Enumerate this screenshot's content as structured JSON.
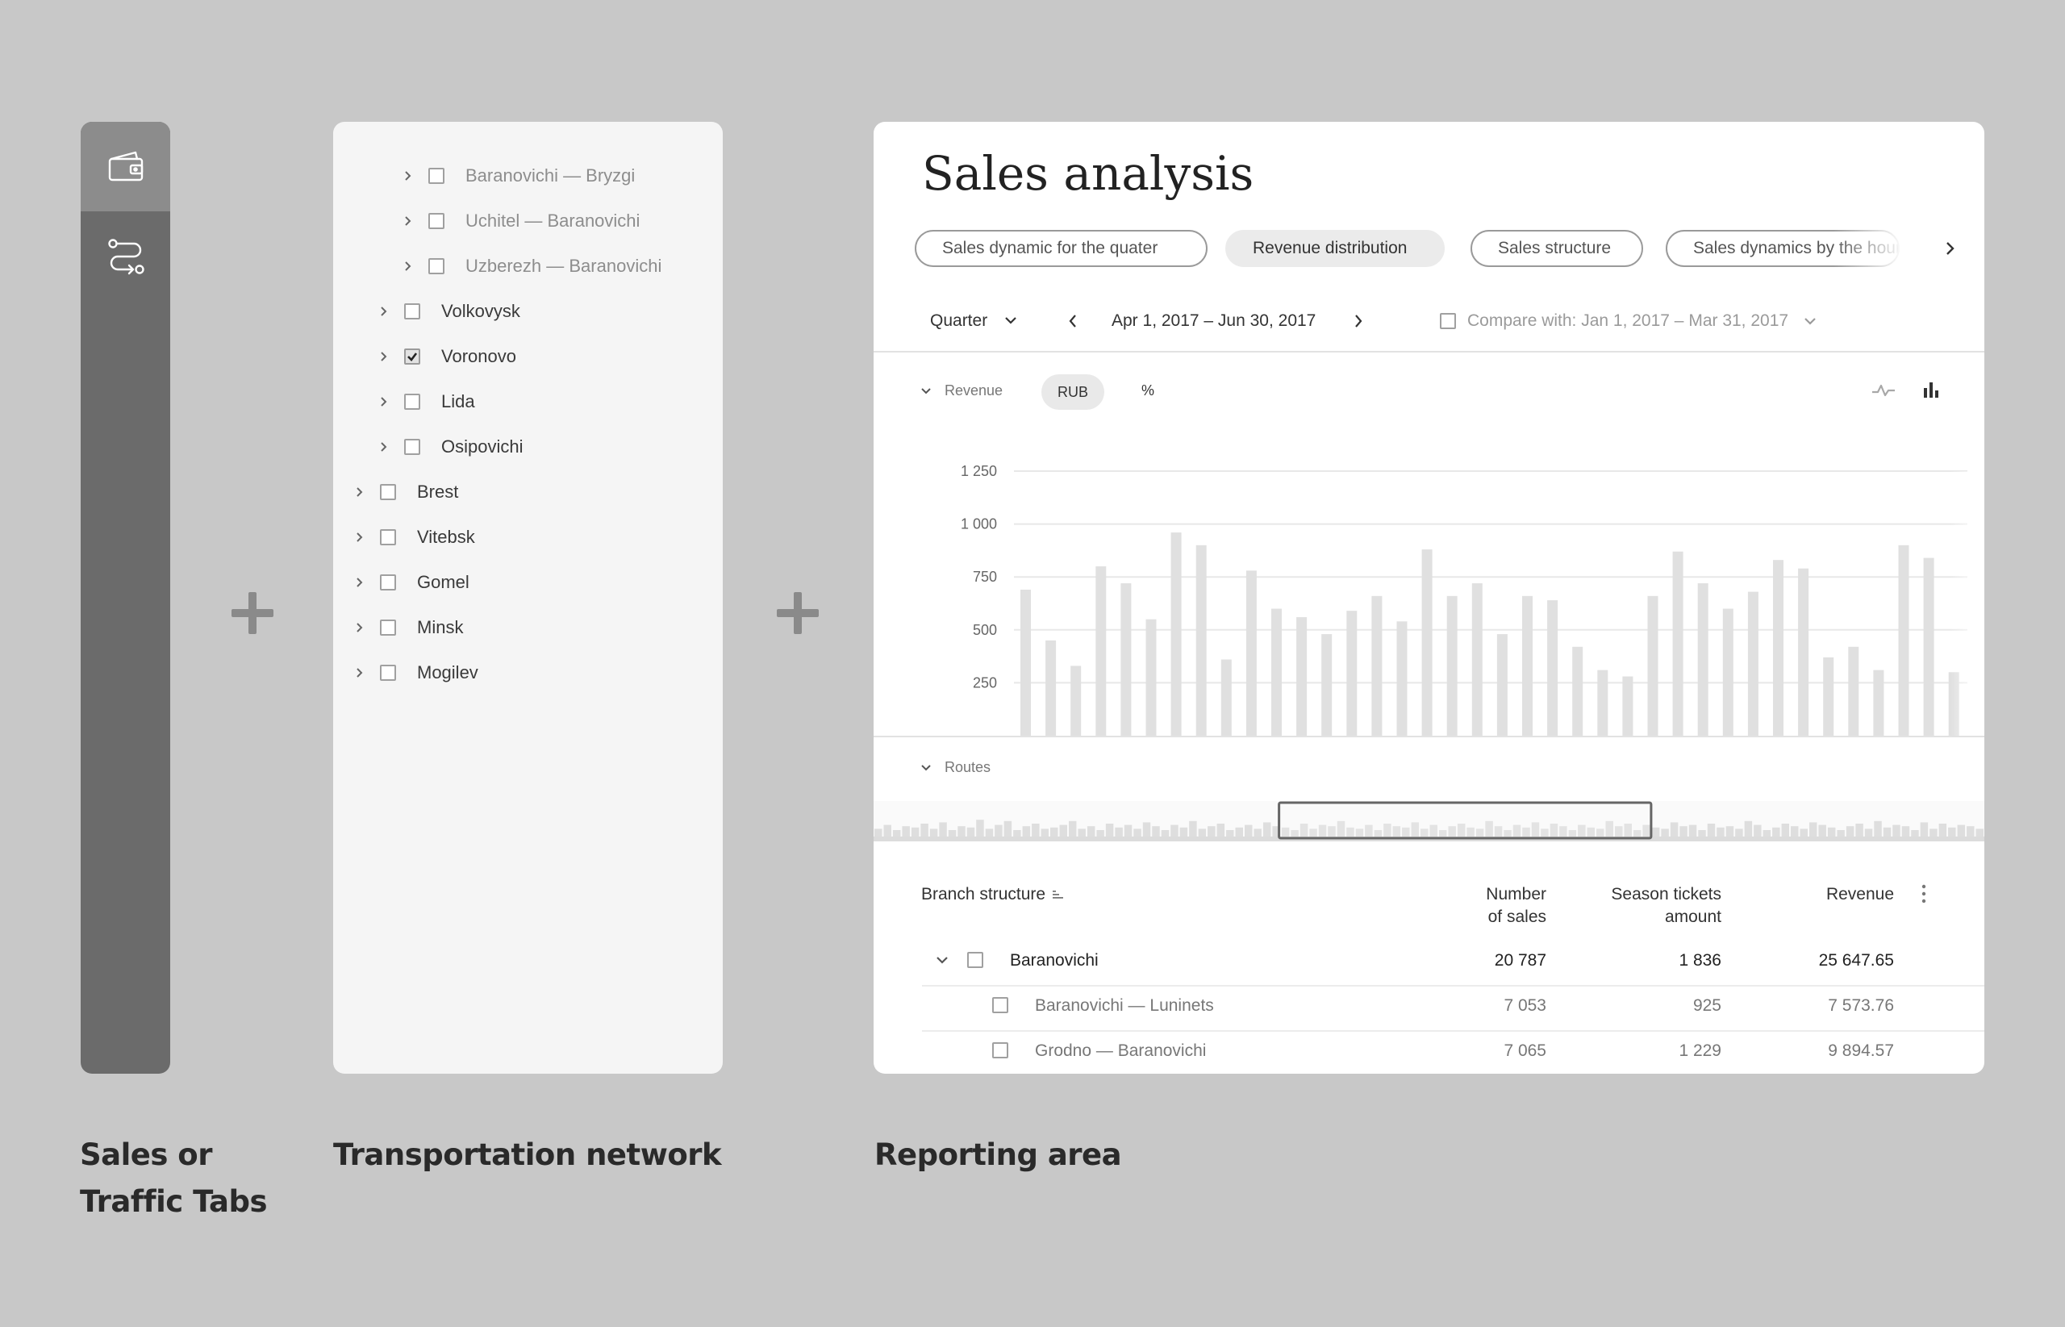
{
  "tabs": [
    {
      "name": "sales",
      "icon": "wallet-icon",
      "active": true
    },
    {
      "name": "traffic",
      "icon": "route-icon",
      "active": false
    }
  ],
  "tree": {
    "items": [
      {
        "label": "Baranovichi — Bryzgi",
        "level": 2,
        "checked": false
      },
      {
        "label": "Uchitel — Baranovichi",
        "level": 2,
        "checked": false
      },
      {
        "label": "Uzberezh — Baranovichi",
        "level": 2,
        "checked": false
      },
      {
        "label": "Volkovysk",
        "level": 1,
        "checked": false
      },
      {
        "label": "Voronovo",
        "level": 1,
        "checked": true
      },
      {
        "label": "Lida",
        "level": 1,
        "checked": false
      },
      {
        "label": "Osipovichi",
        "level": 1,
        "checked": false
      },
      {
        "label": "Brest",
        "level": 0,
        "checked": false
      },
      {
        "label": "Vitebsk",
        "level": 0,
        "checked": false
      },
      {
        "label": "Gomel",
        "level": 0,
        "checked": false
      },
      {
        "label": "Minsk",
        "level": 0,
        "checked": false
      },
      {
        "label": "Mogilev",
        "level": 0,
        "checked": false
      }
    ]
  },
  "report": {
    "title": "Sales analysis",
    "tabs": [
      "Sales dynamic for the quater",
      "Revenue distribution",
      "Sales structure",
      "Sales dynamics by the hours"
    ],
    "active_tab": 1,
    "period": "Quarter",
    "date_range": "Apr 1, 2017 –  Jun 30, 2017",
    "compare": "Compare with: Jan 1, 2017 – Mar 31, 2017",
    "revenue_label": "Revenue",
    "unit_rub": "RUB",
    "unit_pct": "%",
    "routes_label": "Routes",
    "colors": {
      "bar": "#e0e0e0",
      "grid": "#e8e8e8",
      "panel": "#ffffff"
    }
  },
  "chart_data": {
    "type": "bar",
    "ylim": [
      0,
      1250
    ],
    "yticks": [
      250,
      500,
      750,
      1000,
      1250
    ],
    "ytick_labels": [
      "250",
      "500",
      "750",
      "1 000",
      "1 250"
    ],
    "grid": true,
    "values": [
      690,
      450,
      330,
      800,
      720,
      550,
      960,
      900,
      360,
      780,
      600,
      560,
      480,
      590,
      660,
      540,
      880,
      660,
      720,
      480,
      660,
      640,
      420,
      310,
      280,
      660,
      870,
      720,
      600,
      680,
      830,
      790,
      370,
      420,
      310,
      900,
      840,
      300
    ]
  },
  "overview": {
    "values": [
      6,
      9,
      5,
      8,
      7,
      10,
      6,
      11,
      5,
      8,
      7,
      13,
      6,
      9,
      12,
      5,
      8,
      10,
      6,
      7,
      9,
      12,
      6,
      8,
      5,
      10,
      7,
      9,
      6,
      11,
      8,
      5,
      9,
      7,
      12,
      6,
      8,
      10,
      5,
      7,
      9,
      6,
      11,
      8,
      7,
      5,
      10,
      6,
      9,
      8,
      12,
      7,
      6,
      9,
      5,
      10,
      8,
      7,
      11,
      6,
      9,
      5,
      8,
      10,
      7,
      6,
      12,
      8,
      5,
      9,
      7,
      11,
      6,
      10,
      8,
      5,
      9,
      7,
      6,
      12,
      8,
      10,
      5,
      9,
      7,
      6,
      11,
      8,
      9,
      5,
      10,
      7,
      8,
      6,
      12,
      9,
      5,
      7,
      10,
      8,
      6,
      11,
      9,
      7,
      5,
      8,
      10,
      6,
      12,
      7,
      9,
      8,
      5,
      11,
      6,
      10,
      7,
      9,
      8,
      6
    ],
    "window_start": 0.365,
    "window_end": 0.7
  },
  "table": {
    "headers": {
      "branch": "Branch structure",
      "sales_1": "Number",
      "sales_2": "of sales",
      "season_1": "Season tickets",
      "season_2": "amount",
      "revenue": "Revenue"
    },
    "rows": [
      {
        "label": "Baranovichi",
        "sales": "20 787",
        "season": "1 836",
        "revenue": "25 647.65",
        "level": 0
      },
      {
        "label": "Baranovichi — Luninets",
        "sales": "7 053",
        "season": "925",
        "revenue": "7 573.76",
        "level": 1
      },
      {
        "label": "Grodno — Baranovichi",
        "sales": "7 065",
        "season": "1 229",
        "revenue": "9 894.57",
        "level": 1
      }
    ]
  },
  "captions": {
    "tabs_1": "Sales or",
    "tabs_2": "Traffic Tabs",
    "network": "Transportation network",
    "reporting": "Reporting area"
  }
}
